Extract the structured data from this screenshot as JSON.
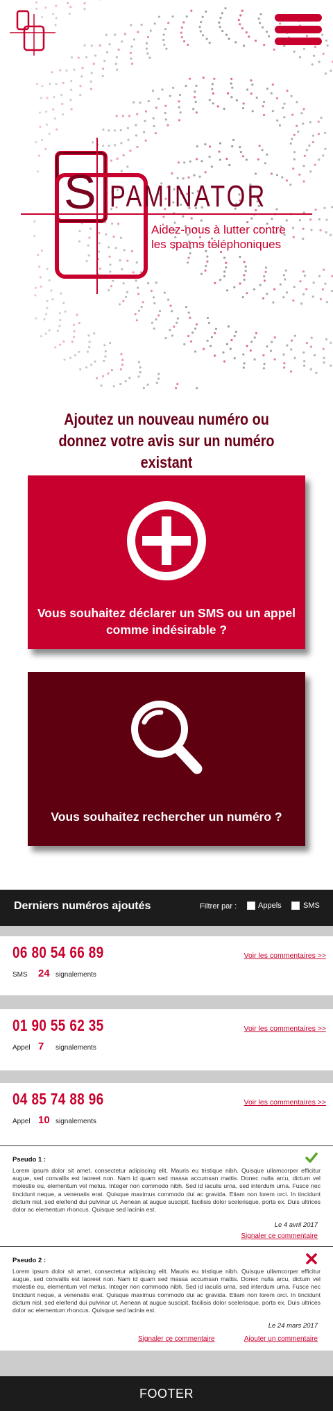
{
  "brand": {
    "name": "PAMINATOR",
    "letter": "S",
    "tagline_line1": "Aidez-nous à lutter contre",
    "tagline_line2": "les spams téléphoniques"
  },
  "headline": {
    "line1": "Ajoutez un nouveau numéro ou",
    "line2": "donnez votre avis sur un numéro existant"
  },
  "cards": [
    {
      "text_line1": "Vous souhaitez déclarer un SMS ou un appel",
      "text_line2": "comme indésirable ?",
      "icon": "plus-circle-icon"
    },
    {
      "text_line1": "Vous souhaitez rechercher un numéro ?",
      "icon": "magnifier-icon"
    }
  ],
  "list": {
    "title": "Derniers numéros ajoutés",
    "filter_label": "Filtrer par :",
    "filter_options": [
      "Appels",
      "SMS"
    ]
  },
  "entries": [
    {
      "number": "06 80 54 66 89",
      "type": "SMS",
      "count": "24",
      "unit": "signalements",
      "link": "Voir les commentaires >>"
    },
    {
      "number": "01 90 55 62 35",
      "type": "Appel",
      "count": "7",
      "unit": "signalements",
      "link": "Voir les commentaires >>"
    },
    {
      "number": "04 85 74 88 96",
      "type": "Appel",
      "count": "10",
      "unit": "signalements",
      "link": "Voir les commentaires >>"
    }
  ],
  "comments": [
    {
      "pseudo": "Pseudo 1 :",
      "body": "Lorem ipsum dolor sit amet, consectetur adipiscing elit. Mauris eu tristique nibh. Quisque ullamcorper efficitur augue, sed convallis est laoreet non. Nam id quam sed massa accumsan mattis. Donec nulla arcu, dictum vel molestie eu, elementum vel metus. Integer non commodo nibh. Sed id iaculis urna, sed interdum urna. Fusce nec tincidunt neque, a venenatis erat. Quisque maximus commodo dui ac gravida. Etiam non lorem orci. In tincidunt dictum nisl, sed eleifend dui pulvinar ut. Aenean at augue suscipit, facilisis dolor scelerisque, porta ex. Duis ultrices dolor ac elementum rhoncus. Quisque sed lacinia est.",
      "date": "Le 4 avril 2017",
      "report_link": "Signaler ce commentaire",
      "status": "check-icon",
      "status_color": "#5aa528"
    },
    {
      "pseudo": "Pseudo 2 :",
      "body": "Lorem ipsum dolor sit amet, consectetur adipiscing elit. Mauris eu tristique nibh. Quisque ullamcorper efficitur augue, sed convallis est laoreet non. Nam id quam sed massa accumsan mattis. Donec nulla arcu, dictum vel molestie eu, elementum vel metus. Integer non commodo nibh. Sed id iaculis urna, sed interdum urna. Fusce nec tincidunt neque, a venenatis erat. Quisque maximus commodo dui ac gravida. Etiam non lorem orci. In tincidunt dictum nisl, sed eleifend dui pulvinar ut. Aenean at augue suscipit, facilisis dolor scelerisque, porta ex. Duis ultrices dolor ac elementum rhoncus. Quisque sed lacinia est.",
      "date": "Le 24 mars 2017",
      "report_link": "Signaler ce commentaire",
      "add_link": "Ajouter un commentaire",
      "status": "cross-icon",
      "status_color": "#c8002d"
    }
  ],
  "footer": {
    "label": "FOOTER"
  },
  "colors": {
    "accent": "#c8002d",
    "dark_red": "#5e0010",
    "bar": "#1c1c1c",
    "separator": "#cccccc"
  }
}
